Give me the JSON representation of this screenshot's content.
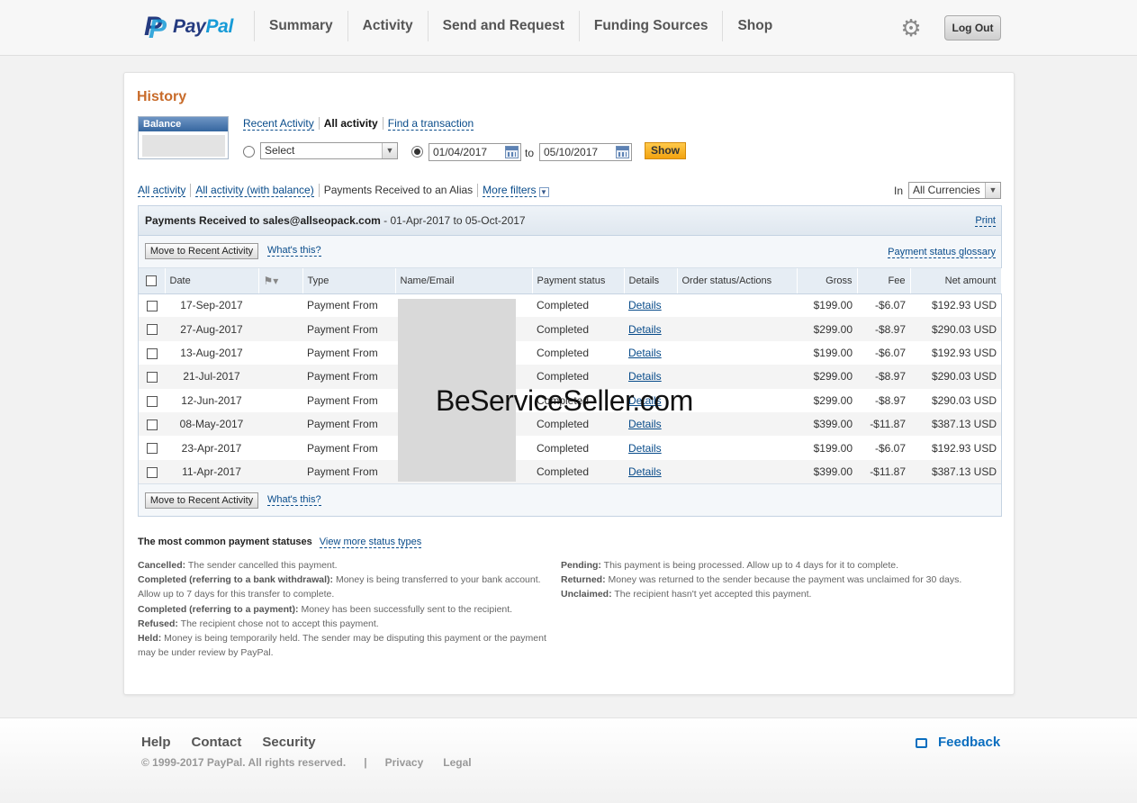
{
  "header": {
    "brand_p": "P",
    "brand_pay": "Pay",
    "brand_pal": "Pal",
    "nav": [
      "Summary",
      "Activity",
      "Send and Request",
      "Funding Sources",
      "Shop"
    ],
    "logout_label": "Log Out",
    "settings_icon": "gear-icon"
  },
  "history": {
    "title": "History",
    "balance_label": "Balance",
    "tabs": {
      "recent": "Recent Activity",
      "all": "All activity",
      "find": "Find a transaction"
    },
    "select_value": "Select",
    "date_from": "01/04/2017",
    "to_label": "to",
    "date_to": "05/10/2017",
    "show_label": "Show"
  },
  "filters": {
    "all_activity": "All activity",
    "all_with_balance": "All activity (with balance)",
    "alias": "Payments Received to an Alias",
    "more_filters": "More filters",
    "in_label": "In",
    "currency": "All Currencies"
  },
  "panel": {
    "title_bold": "Payments Received to sales@allseopack.com",
    "title_range": " - 01-Apr-2017 to 05-Oct-2017",
    "print": "Print",
    "move_label": "Move to Recent Activity",
    "whats_this": "What's this?",
    "glossary": "Payment status glossary",
    "watermark": "BeServiceSeller.com"
  },
  "table": {
    "headers": {
      "date": "Date",
      "type": "Type",
      "name_email": "Name/Email",
      "payment_status": "Payment status",
      "details": "Details",
      "order_status": "Order status/Actions",
      "gross": "Gross",
      "fee": "Fee",
      "net": "Net amount"
    },
    "rows": [
      {
        "date": "17-Sep-2017",
        "type": "Payment From",
        "status": "Completed",
        "details": "Details",
        "gross": "$199.00",
        "fee": "-$6.07",
        "net": "$192.93 USD"
      },
      {
        "date": "27-Aug-2017",
        "type": "Payment From",
        "status": "Completed",
        "details": "Details",
        "gross": "$299.00",
        "fee": "-$8.97",
        "net": "$290.03 USD"
      },
      {
        "date": "13-Aug-2017",
        "type": "Payment From",
        "status": "Completed",
        "details": "Details",
        "gross": "$199.00",
        "fee": "-$6.07",
        "net": "$192.93 USD"
      },
      {
        "date": "21-Jul-2017",
        "type": "Payment From",
        "status": "Completed",
        "details": "Details",
        "gross": "$299.00",
        "fee": "-$8.97",
        "net": "$290.03 USD"
      },
      {
        "date": "12-Jun-2017",
        "type": "Payment From",
        "status": "Completed",
        "details": "Details",
        "gross": "$299.00",
        "fee": "-$8.97",
        "net": "$290.03 USD"
      },
      {
        "date": "08-May-2017",
        "type": "Payment From",
        "status": "Completed",
        "details": "Details",
        "gross": "$399.00",
        "fee": "-$11.87",
        "net": "$387.13 USD"
      },
      {
        "date": "23-Apr-2017",
        "type": "Payment From",
        "status": "Completed",
        "details": "Details",
        "gross": "$199.00",
        "fee": "-$6.07",
        "net": "$192.93 USD"
      },
      {
        "date": "11-Apr-2017",
        "type": "Payment From",
        "status": "Completed",
        "details": "Details",
        "gross": "$399.00",
        "fee": "-$11.87",
        "net": "$387.13 USD"
      }
    ]
  },
  "statuses": {
    "title": "The most common payment statuses",
    "view_more": "View more status types",
    "cancelled_k": "Cancelled:",
    "cancelled_v": " The sender cancelled this payment.",
    "completed_bank_k": "Completed (referring to a bank withdrawal):",
    "completed_bank_v": " Money is being transferred to your bank account. Allow up to 7 days for this transfer to complete.",
    "completed_pay_k": "Completed (referring to a payment):",
    "completed_pay_v": " Money has been successfully sent to the recipient.",
    "refused_k": "Refused:",
    "refused_v": " The recipient chose not to accept this payment.",
    "held_k": "Held:",
    "held_v": " Money is being temporarily held. The sender may be disputing this payment or the payment may be under review by PayPal.",
    "pending_k": "Pending:",
    "pending_v": " This payment is being processed. Allow up to 4 days for it to complete.",
    "returned_k": "Returned:",
    "returned_v": " Money was returned to the sender because the payment was unclaimed for 30 days.",
    "unclaimed_k": "Unclaimed:",
    "unclaimed_v": " The recipient hasn't yet accepted this payment."
  },
  "footer": {
    "help": "Help",
    "contact": "Contact",
    "security": "Security",
    "copyright": "© 1999-2017 PayPal. All rights reserved.",
    "separator": "|",
    "privacy": "Privacy",
    "legal": "Legal",
    "feedback": "Feedback"
  }
}
